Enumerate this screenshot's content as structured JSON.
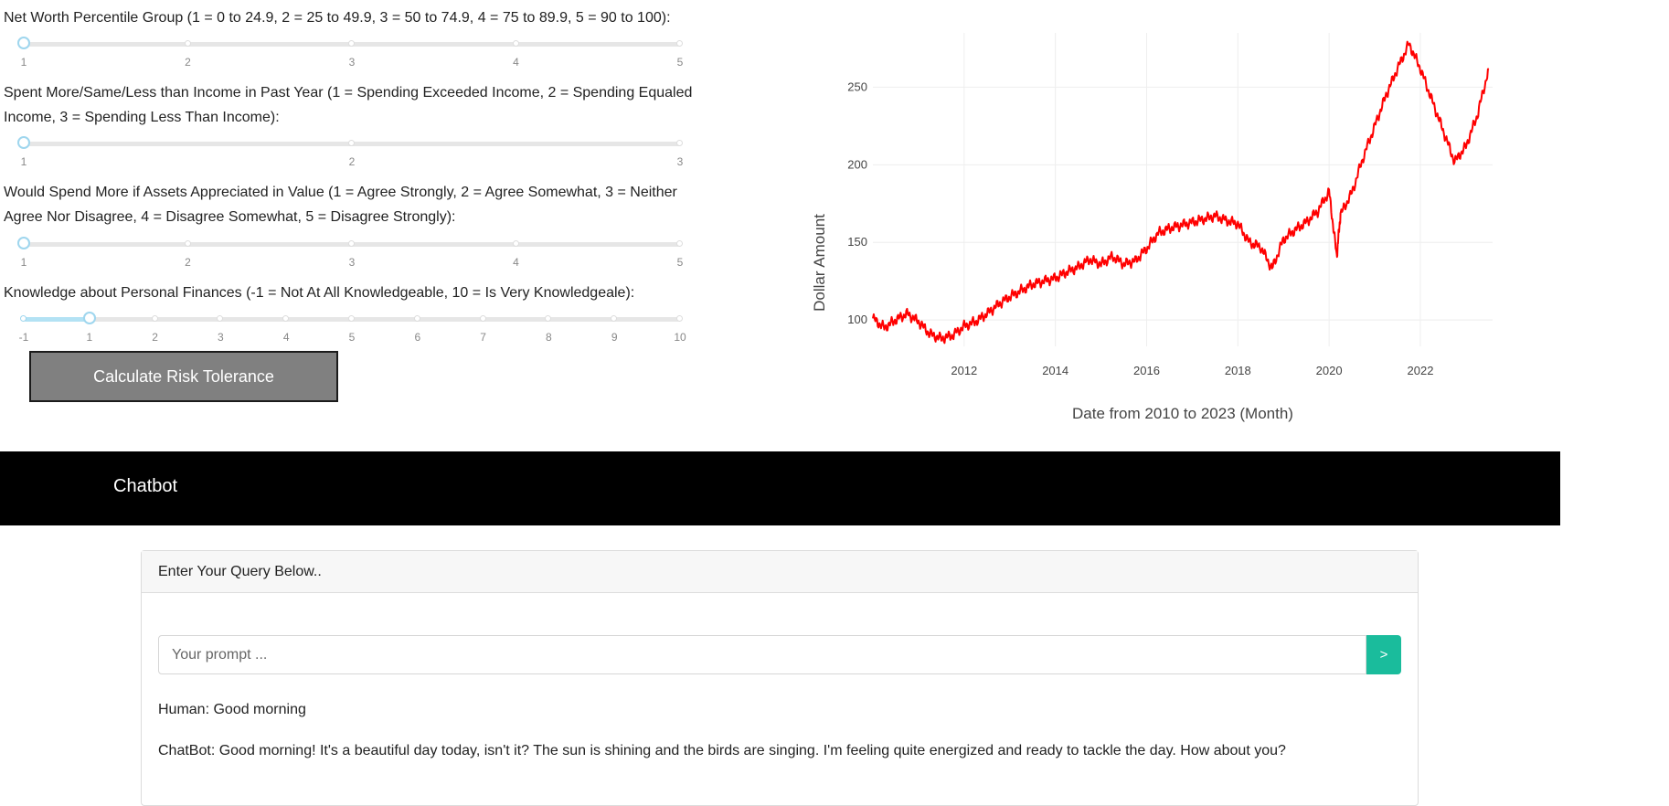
{
  "questions": [
    {
      "label": "Net Worth Percentile Group (1 = 0 to 24.9, 2 = 25 to 49.9, 3 = 50 to 74.9, 4 = 75 to 89.9, 5 = 90 to 100):",
      "ticks": [
        "1",
        "2",
        "3",
        "4",
        "5"
      ],
      "value": "1"
    },
    {
      "label": "Spent More/Same/Less than Income in Past Year (1 = Spending Exceeded Income, 2 = Spending Equaled Income, 3 = Spending Less Than Income):",
      "ticks": [
        "1",
        "2",
        "3"
      ],
      "value": "1"
    },
    {
      "label": "Would Spend More if Assets Appreciated in Value (1 = Agree Strongly, 2 = Agree Somewhat, 3 = Neither Agree Nor Disagree, 4 = Disagree Somewhat, 5 = Disagree Strongly):",
      "ticks": [
        "1",
        "2",
        "3",
        "4",
        "5"
      ],
      "value": "1"
    },
    {
      "label": "Knowledge about Personal Finances (-1 = Not At All Knowledgeable, 10 = Is Very Knowledgeale):",
      "ticks": [
        "-1",
        "1",
        "2",
        "3",
        "4",
        "5",
        "6",
        "7",
        "8",
        "9",
        "10"
      ],
      "value": "1"
    }
  ],
  "calculate_button": "Calculate Risk Tolerance",
  "chart_data": {
    "type": "line",
    "xlabel": "Date from 2010 to 2023 (Month)",
    "ylabel": "Dollar Amount",
    "x_ticks": [
      "2012",
      "2014",
      "2016",
      "2018",
      "2020",
      "2022"
    ],
    "y_ticks": [
      100,
      150,
      200,
      250
    ],
    "xlim": [
      "2010-01",
      "2023-08"
    ],
    "ylim": [
      83,
      285
    ],
    "grid": true,
    "color": "#ff0000",
    "x": [
      "2010-01",
      "2010-04",
      "2010-07",
      "2010-10",
      "2011-01",
      "2011-04",
      "2011-07",
      "2011-10",
      "2012-01",
      "2012-04",
      "2012-07",
      "2012-10",
      "2013-01",
      "2013-04",
      "2013-07",
      "2013-10",
      "2014-01",
      "2014-04",
      "2014-07",
      "2014-10",
      "2015-01",
      "2015-04",
      "2015-07",
      "2015-10",
      "2016-01",
      "2016-04",
      "2016-07",
      "2016-10",
      "2017-01",
      "2017-04",
      "2017-07",
      "2017-10",
      "2018-01",
      "2018-04",
      "2018-07",
      "2018-10",
      "2019-01",
      "2019-04",
      "2019-07",
      "2019-10",
      "2020-01",
      "2020-03",
      "2020-04",
      "2020-07",
      "2020-10",
      "2021-01",
      "2021-04",
      "2021-07",
      "2021-10",
      "2022-01",
      "2022-04",
      "2022-07",
      "2022-10",
      "2023-01",
      "2023-04",
      "2023-07"
    ],
    "values": [
      101,
      95,
      100,
      104,
      99,
      91,
      88,
      90,
      96,
      99,
      104,
      110,
      115,
      119,
      123,
      125,
      127,
      131,
      134,
      139,
      136,
      141,
      136,
      138,
      146,
      156,
      159,
      161,
      163,
      165,
      167,
      164,
      162,
      150,
      147,
      133,
      152,
      158,
      163,
      170,
      183,
      141,
      168,
      182,
      205,
      225,
      245,
      262,
      278,
      262,
      242,
      222,
      202,
      212,
      232,
      262
    ]
  },
  "navbar": {
    "brand": "Chatbot"
  },
  "chat": {
    "header": "Enter Your Query Below..",
    "placeholder": "Your prompt ...",
    "send_label": ">",
    "messages": [
      "Human: Good morning",
      "ChatBot: Good morning! It's a beautiful day today, isn't it? The sun is shining and the birds are singing. I'm feeling quite energized and ready to tackle the day. How about you?"
    ]
  }
}
